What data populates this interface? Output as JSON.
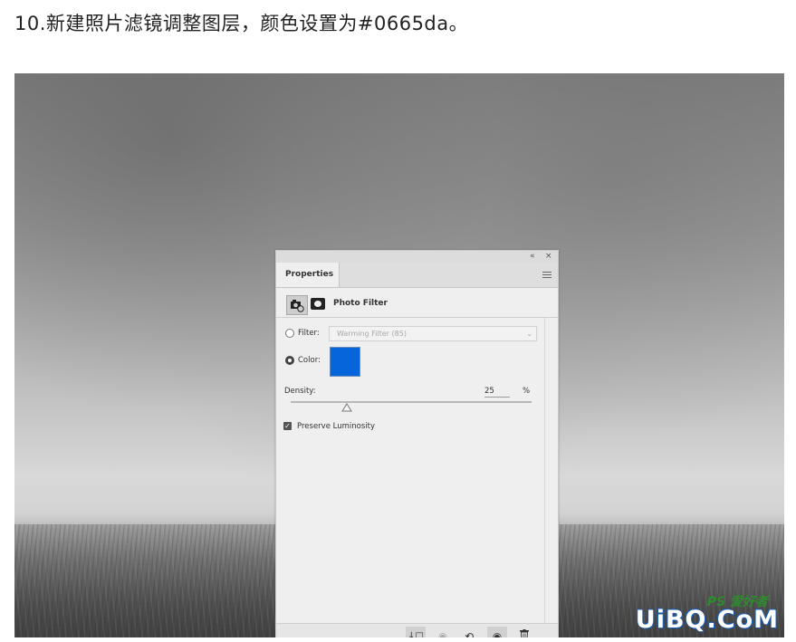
{
  "caption": "10.新建照片滤镜调整图层，颜色设置为#0665da。",
  "panel": {
    "tab_label": "Properties",
    "collapse_glyph": "«",
    "close_glyph": "×",
    "adjustment_title": "Photo Filter",
    "filter_label": "Filter:",
    "filter_value": "Warming Filter (85)",
    "color_label": "Color:",
    "color_value": "#0665da",
    "density_label": "Density:",
    "density_value": "25",
    "density_unit": "%",
    "preserve_luminosity_label": "Preserve Luminosity",
    "preserve_luminosity_checked": true,
    "selected_option": "color"
  },
  "footer_buttons": [
    {
      "name": "clip-to-layer-icon",
      "glyph": "↓□"
    },
    {
      "name": "view-previous-state-icon",
      "glyph": "◉"
    },
    {
      "name": "reset-icon",
      "glyph": "⟲"
    },
    {
      "name": "visibility-eye-icon",
      "glyph": "◉"
    },
    {
      "name": "trash-icon",
      "glyph": "␡"
    }
  ],
  "watermark": {
    "main": "UiBQ.CoM",
    "small": "PS 爱好者"
  }
}
